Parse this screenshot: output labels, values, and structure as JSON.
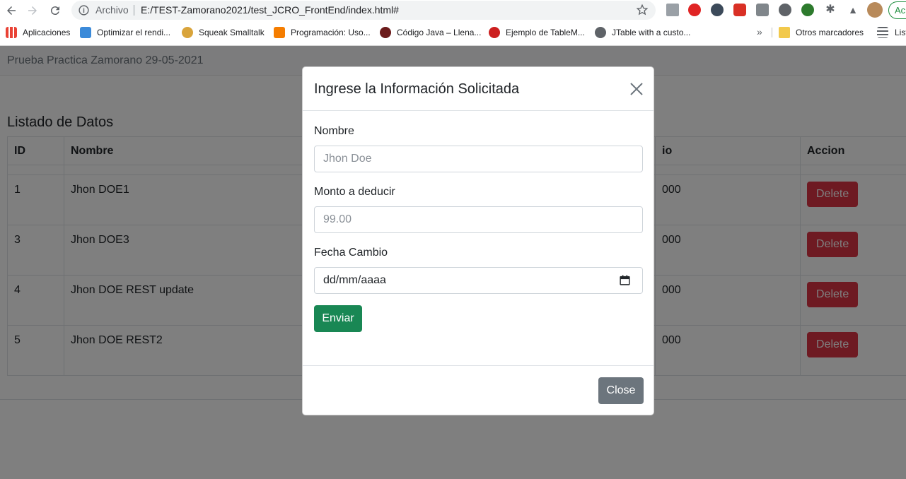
{
  "browser": {
    "scheme_label": "Archivo",
    "url": "E:/TEST-Zamorano2021/test_JCRO_FrontEnd/index.html#",
    "update_label": "Ac",
    "bookmarks": [
      {
        "label": "Aplicaciones",
        "color": "#e94235"
      },
      {
        "label": "Optimizar el rendi...",
        "color": "#3b8ad9"
      },
      {
        "label": "Squeak Smalltalk",
        "color": "#d9a43b"
      },
      {
        "label": "Programación: Uso...",
        "color": "#f57d00"
      },
      {
        "label": "Código Java – Llena...",
        "color": "#6b1b1b"
      },
      {
        "label": "Ejemplo de TableM...",
        "color": "#cc1f1f"
      },
      {
        "label": "JTable with a custo...",
        "color": "#5f6368"
      }
    ],
    "more_label": "»",
    "other_bookmarks": "Otros marcadores",
    "reading_list": "List"
  },
  "page": {
    "brand": "Prueba Practica Zamorano 29-05-2021",
    "list_title": "Listado de Datos",
    "table": {
      "headers": [
        "ID",
        "Nombre",
        "",
        "io",
        "Accion"
      ],
      "rows": [
        {
          "id": "1",
          "nombre": "Jhon DOE1",
          "col4": "000",
          "action": "Delete"
        },
        {
          "id": "3",
          "nombre": "Jhon DOE3",
          "col4": "000",
          "action": "Delete"
        },
        {
          "id": "4",
          "nombre": "Jhon DOE REST update",
          "col4": "000",
          "action": "Delete"
        },
        {
          "id": "5",
          "nombre": "Jhon DOE REST2",
          "col4": "000",
          "action": "Delete"
        }
      ]
    }
  },
  "modal": {
    "title": "Ingrese la Información Solicitada",
    "fields": [
      {
        "label": "Nombre",
        "placeholder": "Jhon Doe"
      },
      {
        "label": "Monto a deducir",
        "placeholder": "99.00"
      },
      {
        "label": "Fecha Cambio",
        "value": "dd/mm/aaaa"
      }
    ],
    "submit_label": "Enviar",
    "close_label": "Close"
  },
  "colors": {
    "danger": "#dc3545",
    "success": "#198754",
    "secondary": "#6c757d"
  }
}
